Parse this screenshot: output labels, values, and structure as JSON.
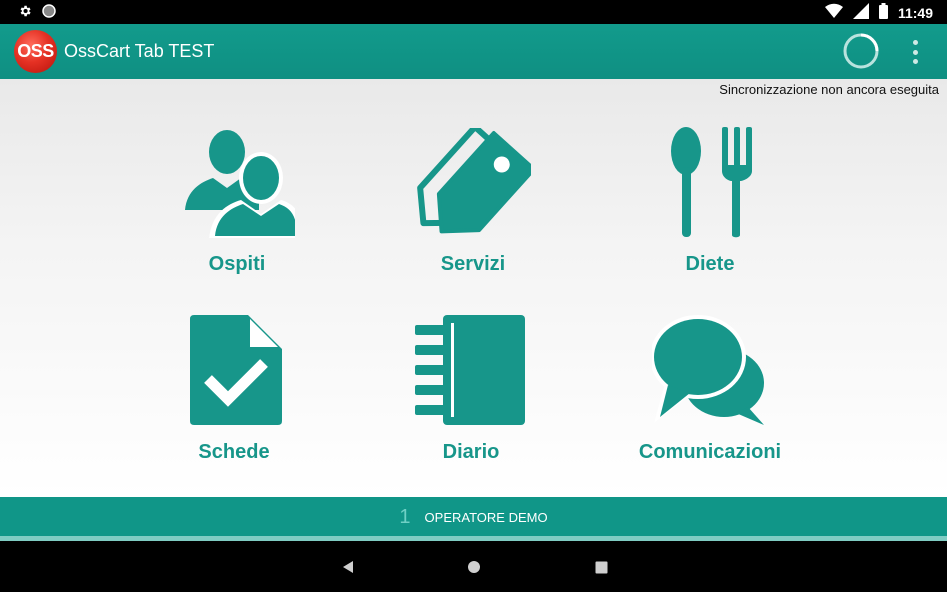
{
  "status_bar": {
    "time": "11:49",
    "icons": [
      "gear-icon",
      "circle-icon",
      "wifi-icon",
      "signal-icon",
      "battery-icon"
    ]
  },
  "app_bar": {
    "logo_text": "OSS",
    "title": "OssCart Tab TEST",
    "icons": [
      "sync-spinner-icon",
      "overflow-menu-icon"
    ]
  },
  "sync_status": "Sincronizzazione non ancora eseguita",
  "menu": [
    {
      "label": "Ospiti",
      "icon": "users-icon"
    },
    {
      "label": "Servizi",
      "icon": "tag-icon"
    },
    {
      "label": "Diete",
      "icon": "fork-spoon-icon"
    },
    {
      "label": "Schede",
      "icon": "checked-document-icon"
    },
    {
      "label": "Diario",
      "icon": "notebook-icon"
    },
    {
      "label": "Comunicazioni",
      "icon": "chat-bubbles-icon"
    }
  ],
  "operator": {
    "number": "1",
    "name": "OPERATORE DEMO"
  },
  "nav_bar": {
    "icons": [
      "back-icon",
      "home-icon",
      "recents-icon"
    ]
  },
  "colors": {
    "primary": "#109688",
    "accent": "#17968a",
    "logo_red": "#e53124"
  }
}
